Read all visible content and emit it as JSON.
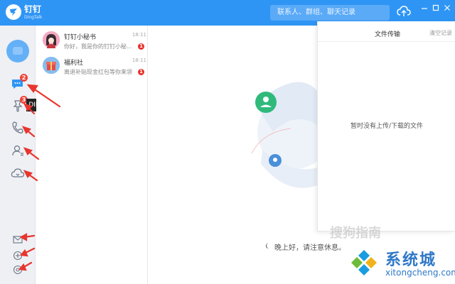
{
  "app": {
    "name": "钉钉",
    "subtitle": "DingTalk",
    "search_placeholder": "联系人、群组、聊天记录"
  },
  "rail": {
    "message_badge": "2",
    "ding_badge": "3",
    "ding_tooltip": "DING",
    "icons": [
      "message-icon",
      "pin-icon",
      "phone-icon",
      "contacts-icon",
      "cloud-icon",
      "mail-icon",
      "add-circle-icon",
      "settings-icon"
    ]
  },
  "conversations": [
    {
      "name": "钉钉小秘书",
      "time": "18:11",
      "message": "你好，我是你的钉钉小秘...",
      "unread": "1"
    },
    {
      "name": "福利社",
      "time": "18:11",
      "message": "离退补贴现金红包等你来领",
      "unread": "1"
    }
  ],
  "main": {
    "greeting": "晚上好，请注意休息。"
  },
  "file_panel": {
    "title": "文件传输",
    "clear_label": "清空记录",
    "empty_text": "暂时没有上传/下载的文件"
  },
  "watermark": {
    "text": "搜狗指南",
    "site_name": "系统城",
    "site_url": "xitongcheng.com"
  },
  "colors": {
    "titlebar": "#2e95f5",
    "badge": "#f0443a",
    "arrow": "#e8352e",
    "accent_green": "#2fba7c"
  }
}
